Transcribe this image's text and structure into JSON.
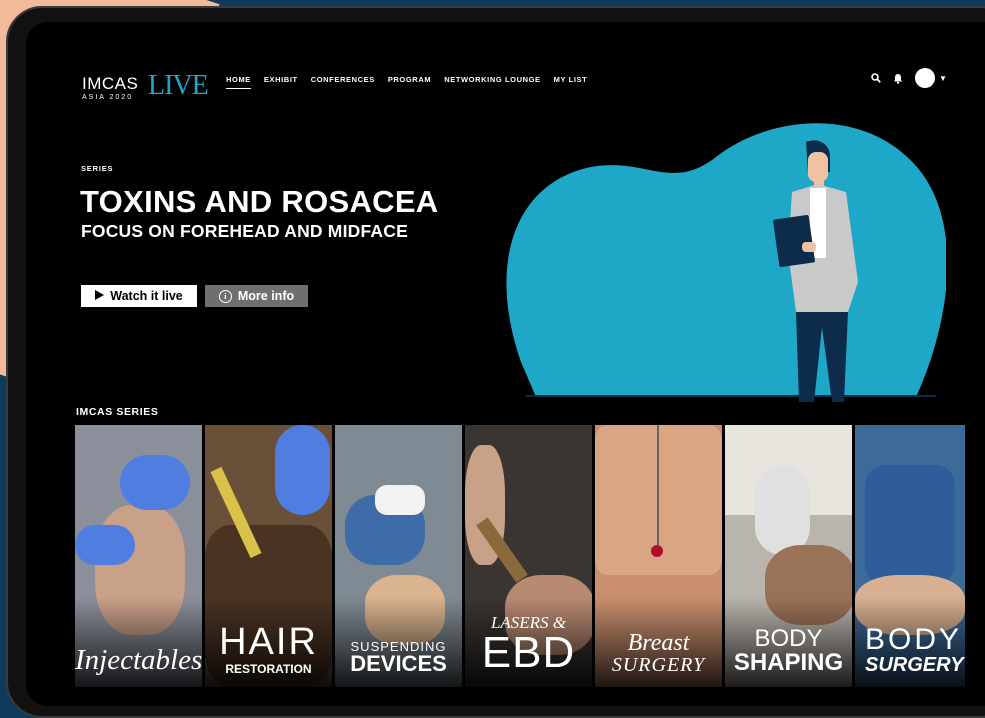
{
  "nav": {
    "logo_main": "IMCAS",
    "logo_sub": "ASIA 2020",
    "logo_live": "LIVE",
    "items": [
      {
        "label": "HOME",
        "active": true
      },
      {
        "label": "EXHIBIT"
      },
      {
        "label": "CONFERENCES"
      },
      {
        "label": "PROGRAM"
      },
      {
        "label": "NETWORKING LOUNGE"
      },
      {
        "label": "MY LIST"
      }
    ],
    "icons": [
      "search-icon",
      "bell-icon",
      "avatar",
      "caret-down-icon"
    ]
  },
  "hero": {
    "eyebrow": "SERIES",
    "title": "TOXINS AND ROSACEA",
    "subtitle": "FOCUS ON FOREHEAD AND MIDFACE",
    "watch_label": "Watch it live",
    "info_label": "More info",
    "info_glyph": "i",
    "accent": "#1ea7c6"
  },
  "series": {
    "title": "IMCAS SERIES",
    "tiles": [
      {
        "line1": "Injectables",
        "line2": ""
      },
      {
        "line1": "HAIR",
        "line2": "RESTORATION"
      },
      {
        "line1": "SUSPENDING",
        "line2": "DEVICES"
      },
      {
        "line1": "LASERS &",
        "line2": "EBD"
      },
      {
        "line1": "Breast",
        "line2": "SURGERY"
      },
      {
        "line1": "BODY",
        "line2": "SHAPING"
      },
      {
        "line1": "BODY",
        "line2": "SURGERY"
      }
    ]
  }
}
